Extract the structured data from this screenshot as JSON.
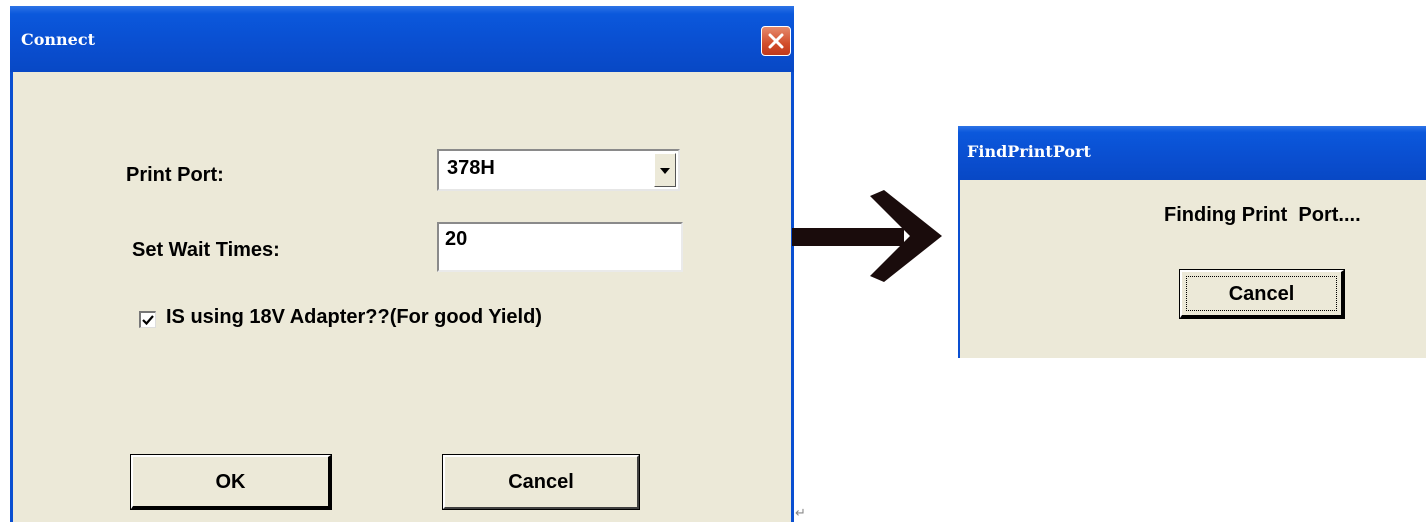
{
  "connect_dialog": {
    "title": "Connect",
    "print_port_label": "Print Port:",
    "print_port_value": "378H",
    "wait_times_label": "Set Wait Times:",
    "wait_times_value": "20",
    "adapter_checkbox_label": "IS using 18V Adapter??(For good Yield)",
    "adapter_checked": true,
    "ok_label": "OK",
    "cancel_label": "Cancel"
  },
  "find_dialog": {
    "title": "FindPrintPort",
    "message": "Finding Print  Port....",
    "cancel_label": "Cancel"
  },
  "icons": {
    "close": "close-icon",
    "dropdown": "chevron-down-icon",
    "check": "checkmark-icon",
    "arrow": "arrow-right-icon"
  },
  "colors": {
    "titlebar_blue": "#0a4fd1",
    "dialog_bg": "#ece9d8",
    "close_red": "#d24d2b"
  }
}
